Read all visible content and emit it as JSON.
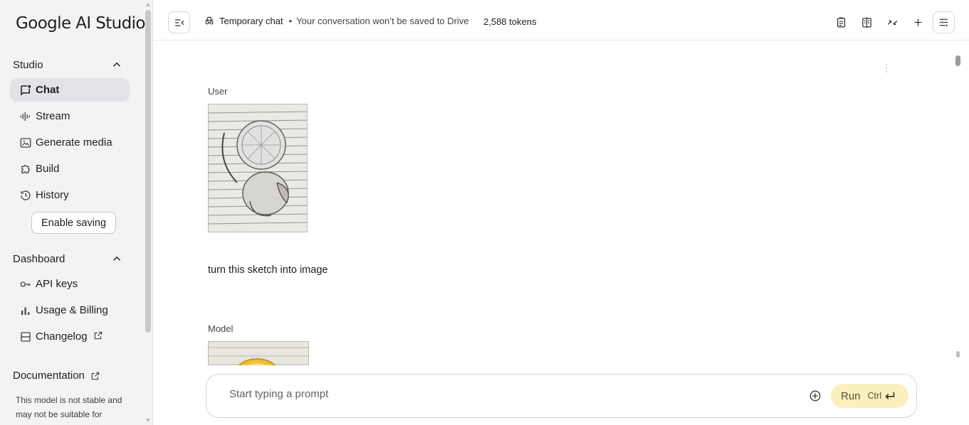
{
  "sidebar": {
    "brand": "Google AI Studio",
    "studio_section": "Studio",
    "items": [
      {
        "label": "Chat",
        "icon": "chat-icon"
      },
      {
        "label": "Stream",
        "icon": "waveform-icon"
      },
      {
        "label": "Generate media",
        "icon": "image-icon"
      },
      {
        "label": "Build",
        "icon": "puzzle-icon"
      },
      {
        "label": "History",
        "icon": "history-icon"
      }
    ],
    "enable_saving": "Enable saving",
    "dashboard_section": "Dashboard",
    "dashboard_items": [
      {
        "label": "API keys",
        "icon": "key-icon"
      },
      {
        "label": "Usage & Billing",
        "icon": "bar-chart-icon"
      },
      {
        "label": "Changelog",
        "icon": "list-icon"
      }
    ],
    "documentation": "Documentation",
    "note": "This model is not stable and may not be suitable for"
  },
  "header": {
    "temp_label": "Temporary chat",
    "bullet": "•",
    "temp_note": "Your conversation won’t be saved to Drive",
    "tokens": "2,588 tokens"
  },
  "chat": {
    "messages": [
      {
        "role": "User",
        "text": "turn this sketch into image"
      },
      {
        "role": "Model"
      }
    ]
  },
  "prompt": {
    "placeholder": "Start typing a prompt",
    "run_label": "Run",
    "shortcut": "Ctrl"
  },
  "colors": {
    "sidebar_bg": "#f3f3f3",
    "active_item_bg": "#e1e3e6",
    "run_button_bg": "#fbefbf"
  }
}
